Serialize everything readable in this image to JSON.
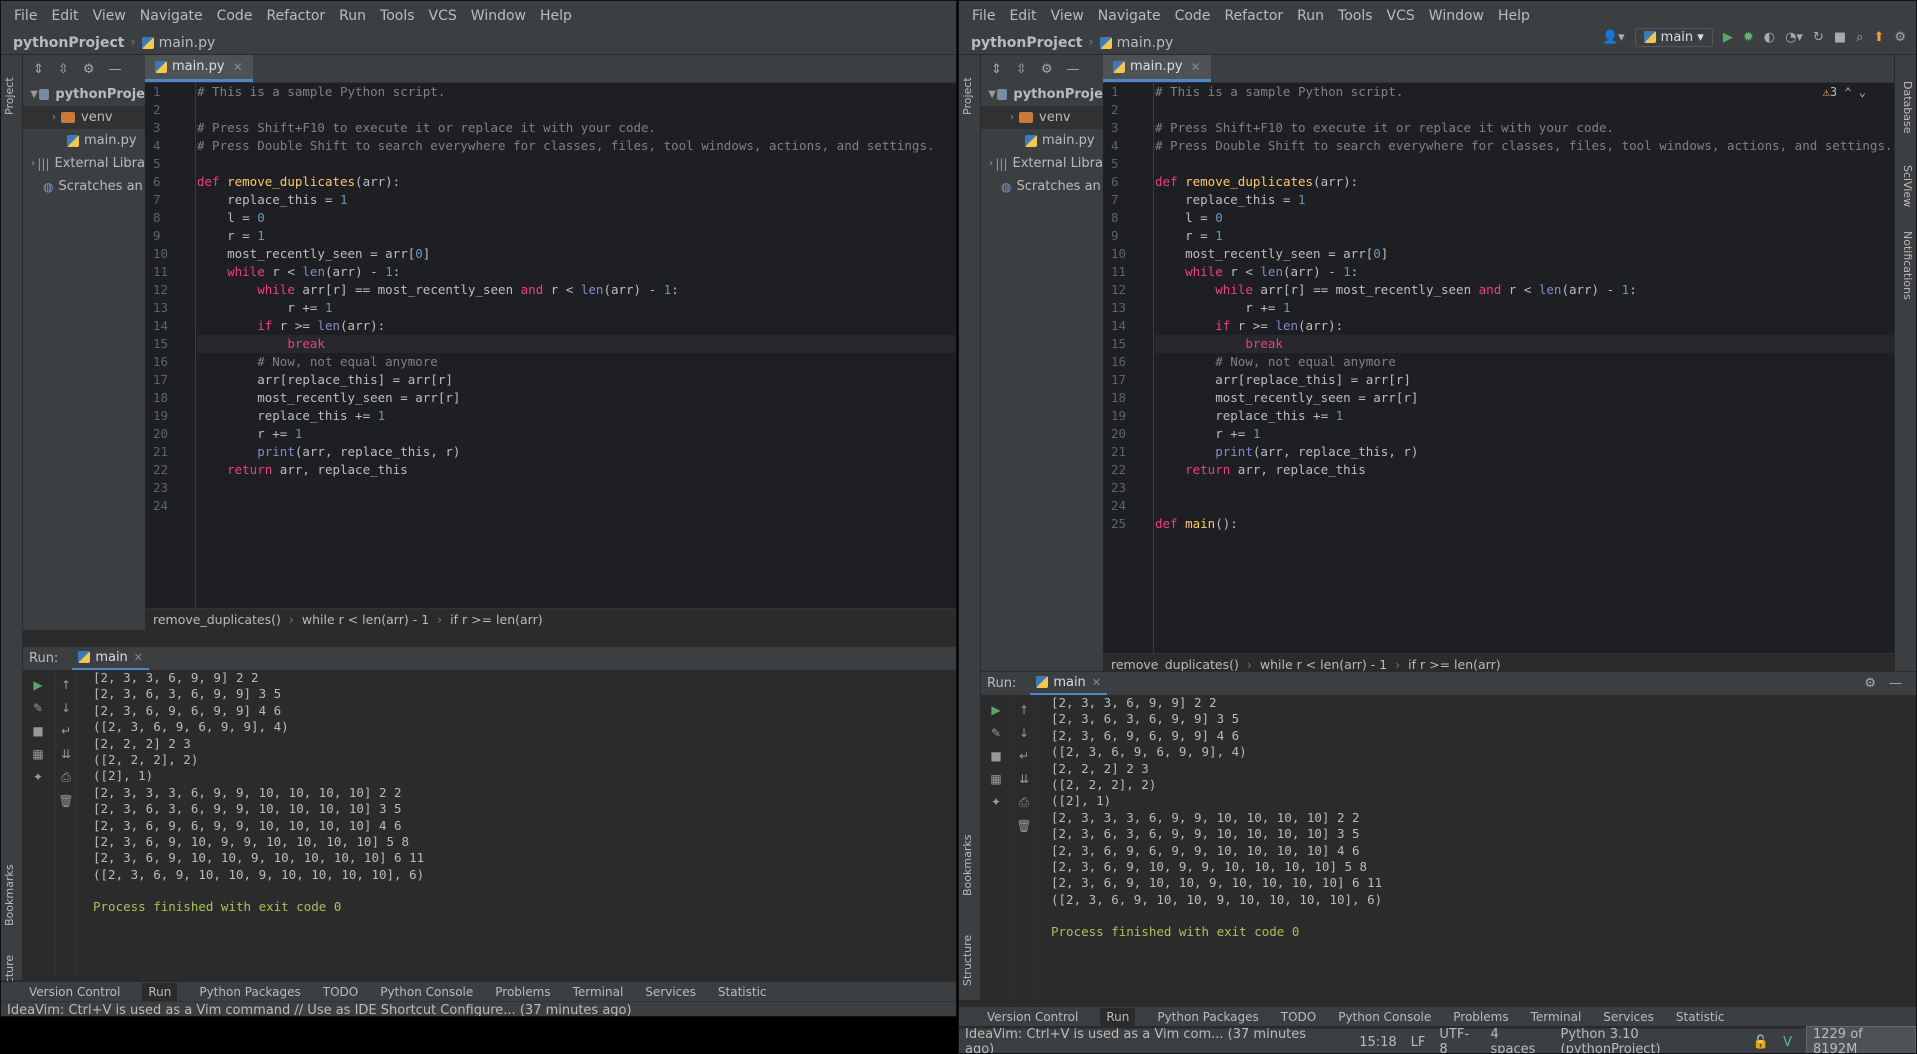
{
  "menu": [
    "File",
    "Edit",
    "View",
    "Navigate",
    "Code",
    "Refactor",
    "Run",
    "Tools",
    "VCS",
    "Window",
    "Help"
  ],
  "project_name": "pythonProject",
  "file_name": "main.py",
  "tree": {
    "root": "pythonProject",
    "root_truncated": "pythonProje",
    "venv": "venv",
    "mainpy": "main.py",
    "external": "External Libra",
    "scratches": "Scratches an"
  },
  "side_tabs": {
    "project": "Project",
    "bookmarks": "Bookmarks",
    "structure": "Structure"
  },
  "right_tabs": {
    "database": "Database",
    "sciview": "SciView",
    "notifications": "Notifications"
  },
  "toolbar": {
    "run_config": "main",
    "warnings_count": "3"
  },
  "code_lines": [
    "# This is a sample Python script.",
    "",
    "# Press Shift+F10 to execute it or replace it with your code.",
    "# Press Double Shift to search everywhere for classes, files, tool windows, actions, and settings.",
    "",
    "def remove_duplicates(arr):",
    "    replace_this = 1",
    "    l = 0",
    "    r = 1",
    "    most_recently_seen = arr[0]",
    "    while r < len(arr) - 1:",
    "        while arr[r] == most_recently_seen and r < len(arr) - 1:",
    "            r += 1",
    "        if r >= len(arr):",
    "            break",
    "        # Now, not equal anymore",
    "        arr[replace_this] = arr[r]",
    "        most_recently_seen = arr[r]",
    "        replace_this += 1",
    "        r += 1",
    "        print(arr, replace_this, r)",
    "    return arr, replace_this",
    "",
    "",
    "def main():"
  ],
  "code_crumbs": [
    "remove_duplicates()",
    "while r < len(arr) - 1",
    "if r >= len(arr)"
  ],
  "run": {
    "label": "Run:",
    "tab": "main",
    "output": [
      "[2, 3, 3, 6, 9, 9] 2 2",
      "[2, 3, 6, 3, 6, 9, 9] 3 5",
      "[2, 3, 6, 9, 6, 9, 9] 4 6",
      "([2, 3, 6, 9, 6, 9, 9], 4)",
      "[2, 2, 2] 2 3",
      "([2, 2, 2], 2)",
      "([2], 1)",
      "[2, 3, 3, 3, 6, 9, 9, 10, 10, 10, 10] 2 2",
      "[2, 3, 6, 3, 6, 9, 9, 10, 10, 10, 10] 3 5",
      "[2, 3, 6, 9, 6, 9, 9, 10, 10, 10, 10] 4 6",
      "[2, 3, 6, 9, 10, 9, 9, 10, 10, 10, 10] 5 8",
      "[2, 3, 6, 9, 10, 10, 9, 10, 10, 10, 10] 6 11",
      "([2, 3, 6, 9, 10, 10, 9, 10, 10, 10, 10], 6)",
      "",
      "Process finished with exit code 0"
    ]
  },
  "bottom_tabs": [
    "Version Control",
    "Run",
    "Python Packages",
    "TODO",
    "Python Console",
    "Problems",
    "Terminal",
    "Services",
    "Statistic"
  ],
  "status": {
    "left_msg": "IdeaVim: Ctrl+V is used as a Vim command // Use as IDE Shortcut   Configure... (37 minutes ago)",
    "right_msg": "IdeaVim: Ctrl+V is used as a Vim com... (37 minutes ago)",
    "position": "15:18",
    "line_sep": "LF",
    "encoding": "UTF-8",
    "indent": "4 spaces",
    "interpreter": "Python 3.10 (pythonProject)",
    "memory": "1229 of 8192M"
  }
}
